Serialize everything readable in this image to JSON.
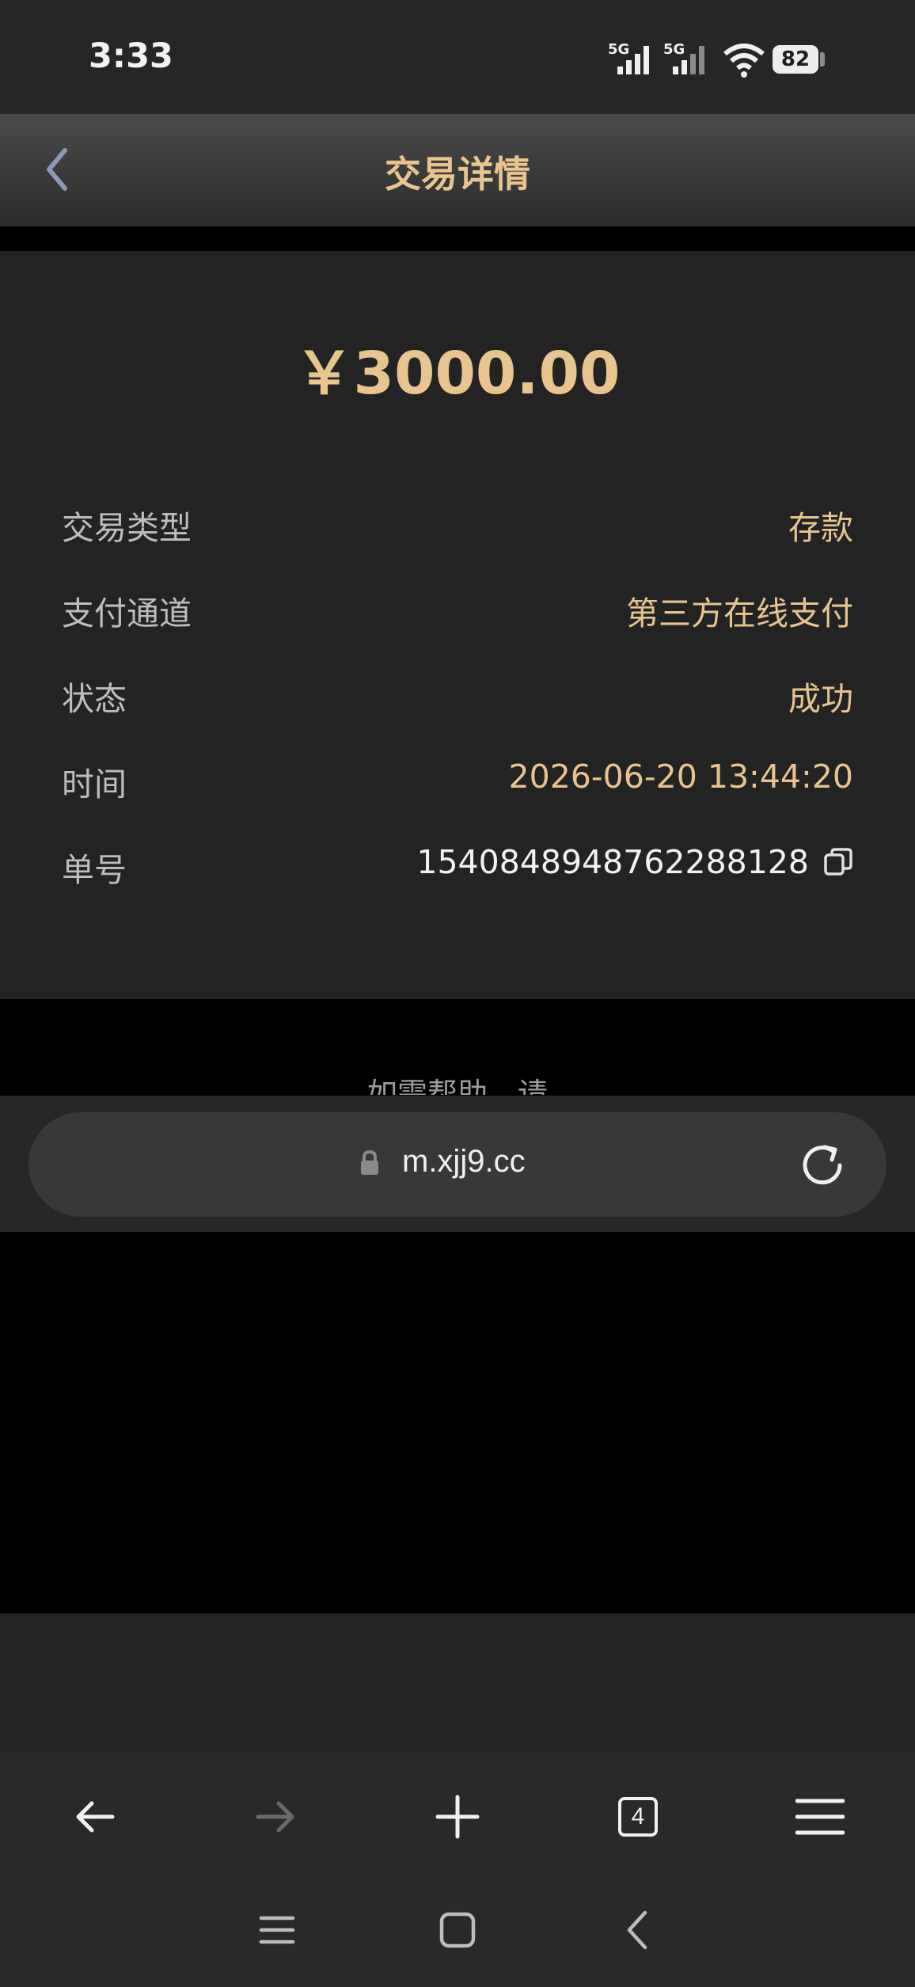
{
  "status_bar": {
    "time": "3:33",
    "network_1": "5G",
    "network_2": "5G",
    "battery": "82"
  },
  "header": {
    "title": "交易详情",
    "back_icon": "chevron-left-icon"
  },
  "transaction": {
    "amount": "￥3000.00",
    "rows": [
      {
        "label": "交易类型",
        "value": "存款"
      },
      {
        "label": "支付通道",
        "value": "第三方在线支付"
      },
      {
        "label": "状态",
        "value": "成功"
      },
      {
        "label": "时间",
        "value": "2026-06-20 13:44:20"
      },
      {
        "label": "单号",
        "value": "1540848948762288128"
      }
    ]
  },
  "help": {
    "text": "如需帮助，请"
  },
  "browser": {
    "url": "m.xjj9.cc",
    "tab_count": "4"
  },
  "colors": {
    "accent_gold": "#e8c48f",
    "card_bg": "#232323",
    "header_bg": "#3a3a3a"
  }
}
